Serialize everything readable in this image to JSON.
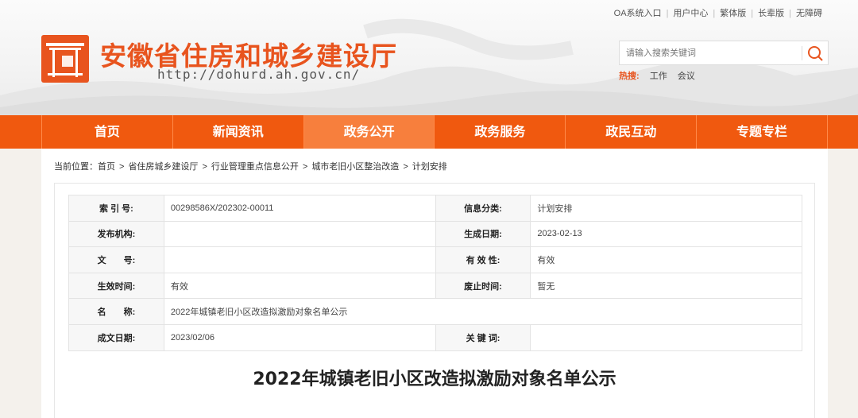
{
  "top_links": [
    "OA系统入口",
    "用户中心",
    "繁体版",
    "长辈版",
    "无障碍"
  ],
  "site": {
    "title": "安徽省住房和城乡建设厅",
    "url": "http://dohurd.ah.gov.cn/"
  },
  "search": {
    "placeholder": "请输入搜索关键词",
    "hot_label": "热搜:",
    "hot_items": [
      "工作",
      "会议"
    ]
  },
  "nav": [
    {
      "label": "首页",
      "active": false
    },
    {
      "label": "新闻资讯",
      "active": false
    },
    {
      "label": "政务公开",
      "active": true
    },
    {
      "label": "政务服务",
      "active": false
    },
    {
      "label": "政民互动",
      "active": false
    },
    {
      "label": "专题专栏",
      "active": false
    }
  ],
  "breadcrumb": {
    "prefix": "当前位置：",
    "items": [
      "首页",
      "省住房城乡建设厅",
      "行业管理重点信息公开",
      "城市老旧小区整治改造",
      "计划安排"
    ]
  },
  "meta": {
    "rows": [
      [
        {
          "label": "索 引 号:",
          "value": "00298586X/202302-00011"
        },
        {
          "label": "信息分类:",
          "value": "计划安排"
        }
      ],
      [
        {
          "label": "发布机构:",
          "value": ""
        },
        {
          "label": "生成日期:",
          "value": "2023-02-13"
        }
      ],
      [
        {
          "label": "文　　号:",
          "value": ""
        },
        {
          "label": "有 效 性:",
          "value": "有效"
        }
      ],
      [
        {
          "label": "生效时间:",
          "value": "有效"
        },
        {
          "label": "废止时间:",
          "value": "暂无"
        }
      ],
      [
        {
          "label": "名　　称:",
          "value": "2022年城镇老旧小区改造拟激励对象名单公示"
        }
      ],
      [
        {
          "label": "成文日期:",
          "value": "2023/02/06"
        },
        {
          "label": "关 键 词:",
          "value": ""
        }
      ]
    ]
  },
  "document": {
    "title": "2022年城镇老旧小区改造拟激励对象名单公示"
  },
  "colors": {
    "brand_orange": "#f0590f",
    "nav_active": "#f77f3d",
    "title_orange": "#e8541e"
  },
  "icons": {
    "logo": "emblem-icon",
    "search": "search-icon"
  }
}
